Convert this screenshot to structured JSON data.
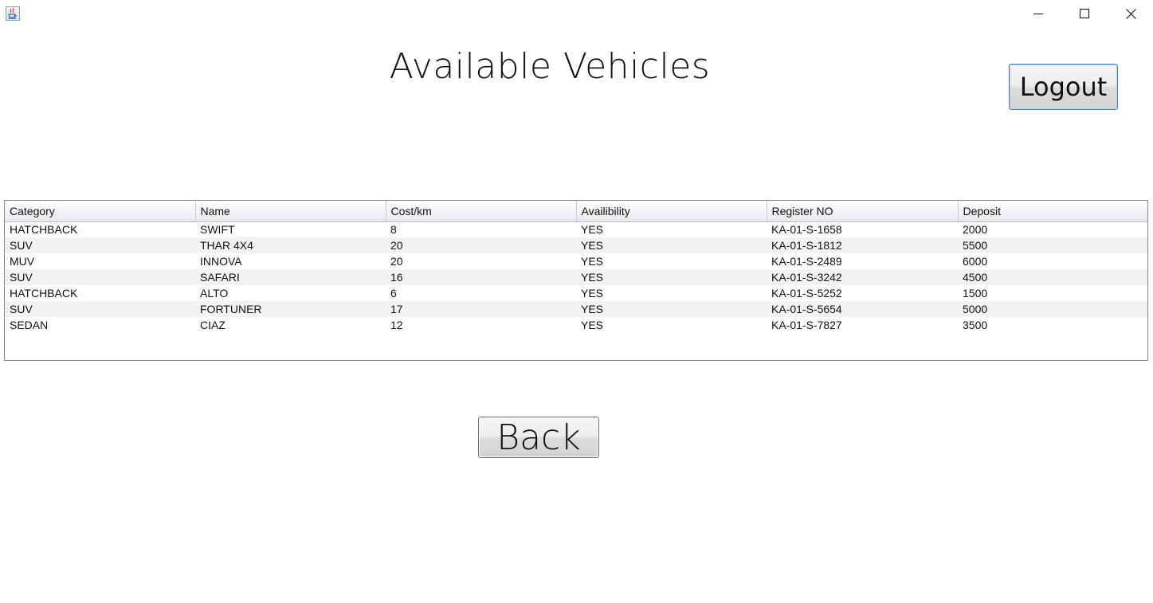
{
  "window": {
    "app_icon": "java-coffee-cup-icon",
    "controls": {
      "minimize_icon": "minimize-icon",
      "maximize_icon": "maximize-icon",
      "close_icon": "close-icon"
    }
  },
  "page": {
    "title": "Available Vehicles"
  },
  "buttons": {
    "logout_label": "Logout",
    "back_label": "Back"
  },
  "table": {
    "columns": [
      "Category",
      "Name",
      "Cost/km",
      "Availibility",
      "Register NO",
      "Deposit"
    ],
    "rows": [
      [
        "HATCHBACK",
        "SWIFT",
        "8",
        "YES",
        "KA-01-S-1658",
        "2000"
      ],
      [
        "SUV",
        "THAR 4X4",
        "20",
        "YES",
        "KA-01-S-1812",
        "5500"
      ],
      [
        "MUV",
        "INNOVA",
        "20",
        "YES",
        "KA-01-S-2489",
        "6000"
      ],
      [
        "SUV",
        "SAFARI",
        "16",
        "YES",
        "KA-01-S-3242",
        "4500"
      ],
      [
        "HATCHBACK",
        "ALTO",
        "6",
        "YES",
        "KA-01-S-5252",
        "1500"
      ],
      [
        "SUV",
        "FORTUNER",
        "17",
        "YES",
        "KA-01-S-5654",
        "5000"
      ],
      [
        "SEDAN",
        "CIAZ",
        "12",
        "YES",
        "KA-01-S-7827",
        "3500"
      ]
    ]
  }
}
